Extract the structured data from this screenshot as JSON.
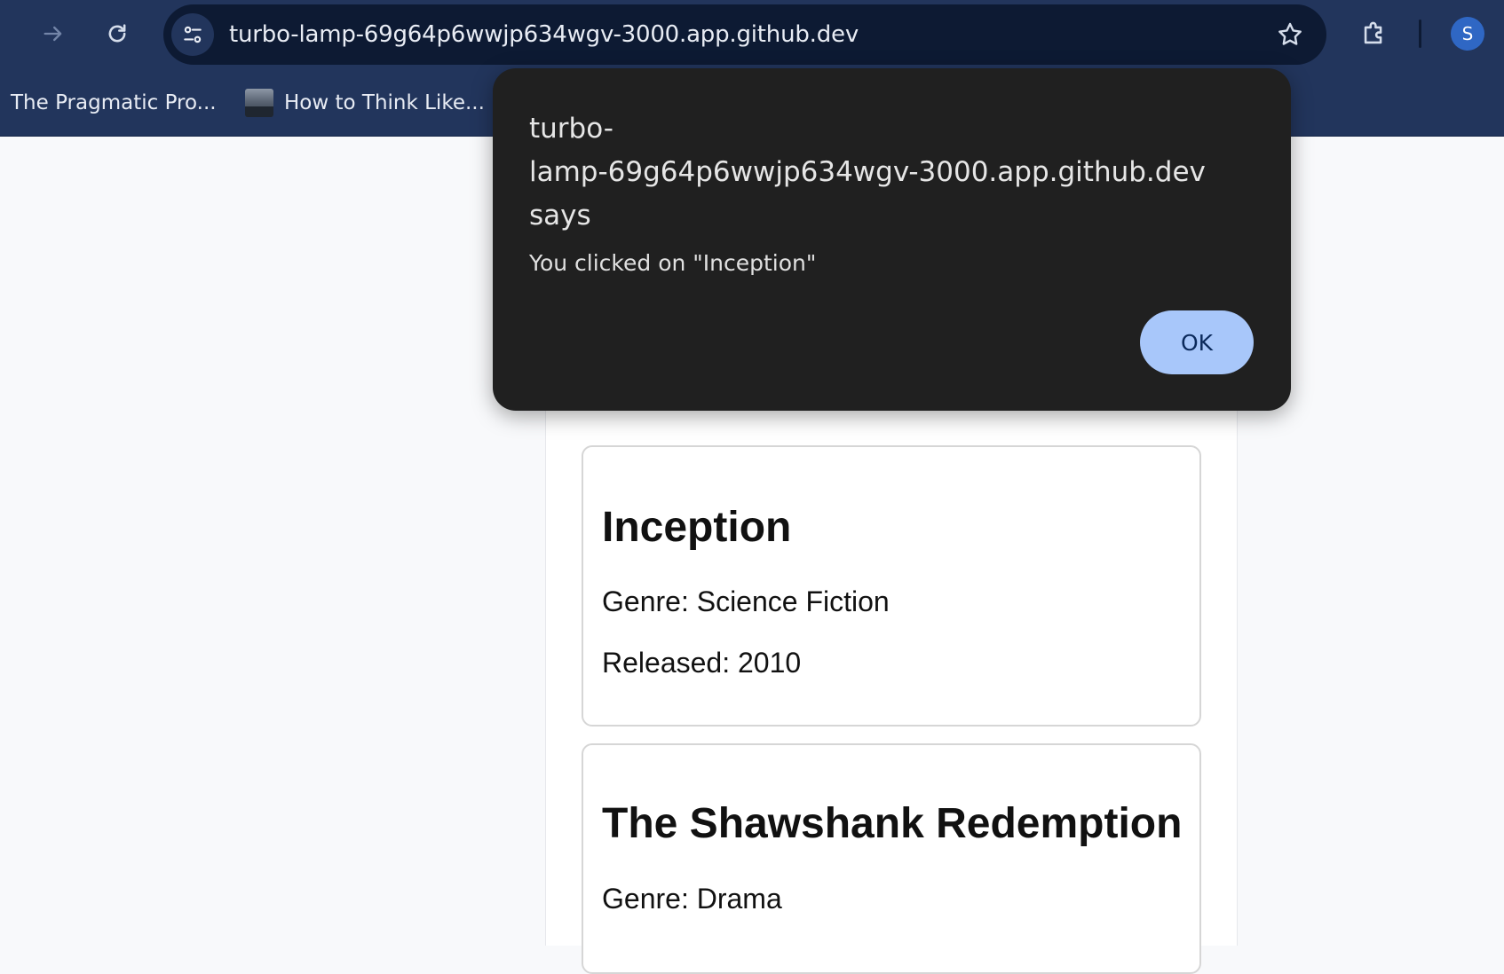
{
  "browser": {
    "url": "turbo-lamp-69g64p6wwjp634wgv-3000.app.github.dev",
    "profile_initial": "S",
    "bookmarks": [
      {
        "label": "The Pragmatic Pro..."
      },
      {
        "label": "How to Think Like..."
      }
    ]
  },
  "dialog": {
    "title_line1": "turbo-",
    "title_line2": "lamp-69g64p6wwjp634wgv-3000.app.github.dev",
    "title_line3": "says",
    "message": "You clicked on \"Inception\"",
    "ok_label": "OK"
  },
  "movies": [
    {
      "title": "Inception",
      "genre": "Genre: Science Fiction",
      "released": "Released: 2010"
    },
    {
      "title": "The Shawshank Redemption",
      "genre": "Genre: Drama"
    }
  ],
  "colors": {
    "toolbar": "#22355c",
    "omnibox": "#0d1a33",
    "dialog_bg": "#202020",
    "ok_button": "#a8c7fa",
    "avatar": "#2f67c4"
  }
}
